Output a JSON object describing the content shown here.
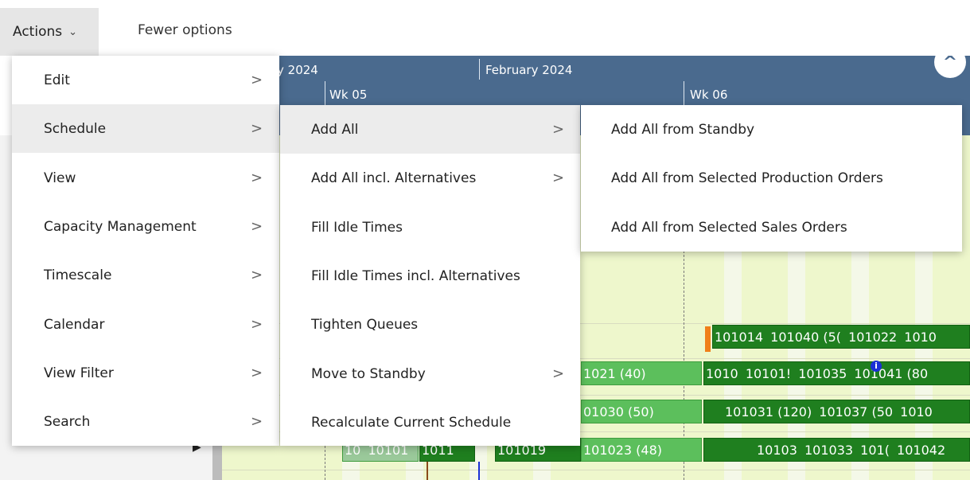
{
  "toolbar": {
    "actions_label": "Actions",
    "fewer_label": "Fewer options"
  },
  "gantt": {
    "month_prev": "y 2024",
    "month_next": "February 2024",
    "week_a": "Wk 05",
    "week_b": "Wk 06",
    "row1_bars": [
      "101014",
      "101040 (5(",
      "101022",
      "1010"
    ],
    "row2_bars": [
      "1021 (40)",
      "1010",
      "10101!",
      "101035",
      "101041 (80"
    ],
    "row3_bars": [
      "01030 (50)",
      "101031 (120)",
      "101037 (50",
      "1010"
    ],
    "row4_bars": [
      "10",
      "10101",
      "1011",
      "101019",
      "101023 (48)",
      "10103",
      "101033",
      "101(",
      "101042"
    ]
  },
  "menu_main": {
    "items": [
      {
        "label": "Edit"
      },
      {
        "label": "Schedule"
      },
      {
        "label": "View"
      },
      {
        "label": "Capacity Management"
      },
      {
        "label": "Timescale"
      },
      {
        "label": "Calendar"
      },
      {
        "label": "View Filter"
      },
      {
        "label": "Search"
      }
    ]
  },
  "menu_schedule": {
    "items": [
      {
        "label": "Add All"
      },
      {
        "label": "Add All incl. Alternatives"
      },
      {
        "label": "Fill Idle Times"
      },
      {
        "label": "Fill Idle Times incl. Alternatives"
      },
      {
        "label": "Tighten Queues"
      },
      {
        "label": "Move to Standby"
      },
      {
        "label": "Recalculate Current Schedule"
      }
    ]
  },
  "menu_add_all": {
    "items": [
      {
        "label": "Add All from Standby"
      },
      {
        "label": "Add All from Selected Production Orders"
      },
      {
        "label": "Add All from Selected Sales Orders"
      }
    ]
  },
  "colors": {
    "header_bg": "#4a6a8e",
    "bar_dark": "#1f7f1f",
    "bar_light": "#5cbf5c",
    "body_bg": "#eef7cc"
  }
}
